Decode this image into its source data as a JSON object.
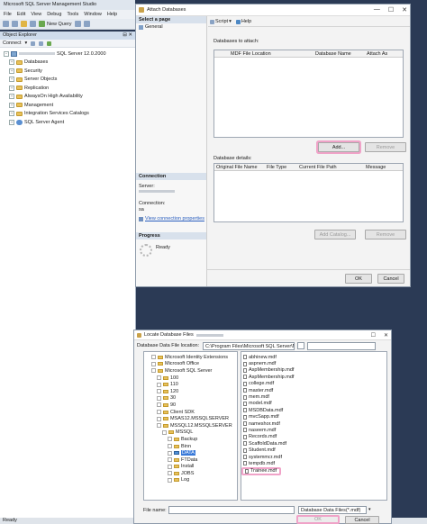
{
  "ssms": {
    "title": "Microsoft SQL Server Management Studio",
    "menu": [
      "File",
      "Edit",
      "View",
      "Debug",
      "Tools",
      "Window",
      "Help"
    ],
    "new_query": "New Query",
    "object_explorer": {
      "title": "Object Explorer",
      "connect": "Connect",
      "server_node": "SQL Server 12.0.2000",
      "nodes": [
        "Databases",
        "Security",
        "Server Objects",
        "Replication",
        "AlwaysOn High Availability",
        "Management",
        "Integration Services Catalogs",
        "SQL Server Agent"
      ]
    },
    "status": "Ready"
  },
  "attach": {
    "title": "Attach Databases",
    "select_page": "Select a page",
    "page_general": "General",
    "toolbar": {
      "script": "Script",
      "help": "Help"
    },
    "databases_label": "Databases to attach:",
    "db_columns": [
      "MDF File Location",
      "Database Name",
      "Attach As"
    ],
    "add_button": "Add...",
    "remove_button": "Remove",
    "details_label": "Database details:",
    "details_columns": [
      "Original File Name",
      "File Type",
      "Current File Path",
      "Message"
    ],
    "add_catalog_button": "Add Catalog...",
    "remove_button_2": "Remove",
    "connection_title": "Connection",
    "server_label": "Server:",
    "connection_label": "Connection:",
    "connection_value": "sa",
    "view_props_link": "View connection properties",
    "progress_title": "Progress",
    "progress_status": "Ready",
    "ok_button": "OK",
    "cancel_button": "Cancel"
  },
  "locate": {
    "title": "Locate Database Files",
    "location_label": "Database Data File location:",
    "location_value": "C:\\Program Files\\Microsoft SQL Server\\MSSQL",
    "tree": [
      {
        "label": "Microsoft Identity Extensions",
        "level": 1
      },
      {
        "label": "Microsoft Office",
        "level": 1
      },
      {
        "label": "Microsoft SQL Server",
        "level": 1
      },
      {
        "label": "100",
        "level": 2
      },
      {
        "label": "110",
        "level": 2
      },
      {
        "label": "120",
        "level": 2
      },
      {
        "label": "30",
        "level": 2
      },
      {
        "label": "90",
        "level": 2
      },
      {
        "label": "Client SDK",
        "level": 2
      },
      {
        "label": "MSAS12.MSSQLSERVER",
        "level": 2
      },
      {
        "label": "MSSQL12.MSSQLSERVER",
        "level": 2
      },
      {
        "label": "MSSQL",
        "level": 3
      },
      {
        "label": "Backup",
        "level": 4
      },
      {
        "label": "Binn",
        "level": 4
      },
      {
        "label": "DATA",
        "level": 4,
        "selected": true
      },
      {
        "label": "FTData",
        "level": 4
      },
      {
        "label": "Install",
        "level": 4
      },
      {
        "label": "JOBS",
        "level": 4
      },
      {
        "label": "Log",
        "level": 4
      }
    ],
    "files": [
      "abhinew.mdf",
      "aspnem.mdf",
      "AspMembership.mdf",
      "AspMembership.mdf",
      "college.mdf",
      "master.mdf",
      "mem.mdf",
      "model.mdf",
      "MSDBData.mdf",
      "mvcSapp.mdf",
      "nameshor.mdf",
      "naseem.mdf",
      "Records.mdf",
      "ScaffoldData.mdf",
      "Student.mdf",
      "systemmcr.mdf",
      "tempdb.mdf"
    ],
    "highlighted_file": "Trainee.mdf",
    "file_name_label": "File name:",
    "filter_value": "Database Data Files(*.mdf)",
    "ok_button": "OK",
    "cancel_button": "Cancel"
  },
  "colors": {
    "highlight": "#f0a3c8",
    "selection": "#3879d9",
    "folder": "#e8c15a"
  }
}
